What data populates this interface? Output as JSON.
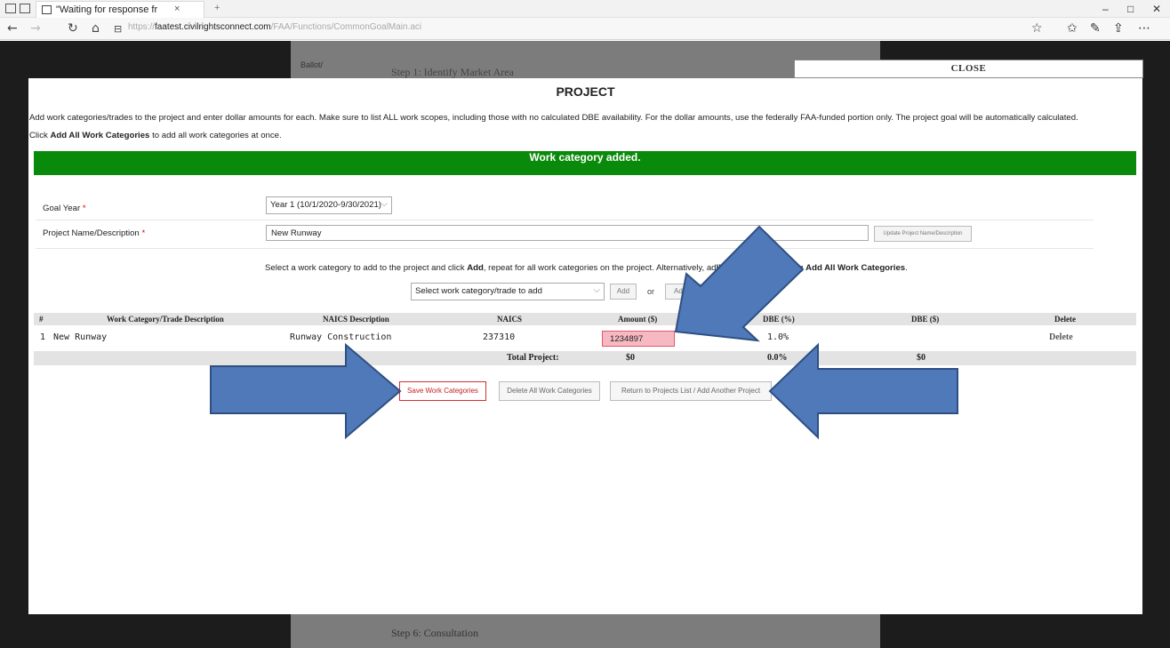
{
  "browser": {
    "tab_title": "\"Waiting for response fr",
    "tab_close": "×",
    "new_tab": "+",
    "url_host": "faatest.civilrightsconnect.com",
    "url_prefix": "https://",
    "url_path": "/FAA/Functions/CommonGoalMain.aci",
    "window_controls": [
      "–",
      "□",
      "✕"
    ]
  },
  "background": {
    "title_text": "Step 1: Identify Market Area",
    "label_text": "Ballot/",
    "footer_text": "Step 6: Consultation"
  },
  "modal": {
    "close_label": "CLOSE",
    "title": "PROJECT",
    "instruction_1": "Add work categories/trades to the project and enter dollar amounts for each. Make sure to list ALL work scopes, including those with no calculated DBE availability. For the dollar amounts, use the federally FAA-funded portion only. The project goal will be automatically calculated.",
    "instruction_2_pre": "Click ",
    "instruction_2_bold": "Add All Work Categories",
    "instruction_2_post": " to add all work categories at once.",
    "success_message": "Work category added.",
    "goal_year_label": "Goal Year",
    "goal_year_value": "Year 1 (10/1/2020-9/30/2021)",
    "project_name_label": "Project Name/Description",
    "project_name_value": "New Runway",
    "update_name_button": "Update Project Name/Description",
    "select_instruction_1": "Select a work category to add to the project and click ",
    "select_instruction_add": "Add",
    "select_instruction_2": ", repeat for all work categories on the project. Alternatively, ad",
    "select_instruction_3": "ll wo",
    "select_instruction_4": "ng ",
    "select_instruction_bold": "Add All Work Categories",
    "select_instruction_end": ".",
    "category_placeholder": "Select work category/trade to add",
    "add_button": "Add",
    "or_text": "or",
    "add_all_button": "Add",
    "table": {
      "headers": [
        "#",
        "Work Category/Trade Description",
        "NAICS Description",
        "NAICS",
        "Amount ($)",
        "DBE (%)",
        "DBE ($)",
        "Delete"
      ],
      "row": {
        "num": "1",
        "category": "New Runway",
        "naics_desc": "Runway Construction",
        "naics": "237310",
        "amount": "1234897",
        "dbe_pct": "1.0%",
        "delete": "Delete"
      },
      "total_label": "Total Project:",
      "total_amount": "$0",
      "total_dbe_pct": "0.0%",
      "total_dbe_amt": "$0"
    },
    "save_button": "Save Work Categories",
    "delete_all_button": "Delete All Work Categories",
    "return_button": "Return to Projects List / Add Another Project"
  },
  "colors": {
    "success": "#0a8a0a",
    "arrow_fill": "#4f79b8",
    "arrow_stroke": "#2e4f82",
    "amount_highlight": "#f6b9c2",
    "primary_button_text": "#c81e1e"
  },
  "icons": [
    "back-icon",
    "forward-icon",
    "refresh-icon",
    "home-icon",
    "lock-icon",
    "favorite-star-icon",
    "favorites-list-icon",
    "pen-icon",
    "share-icon",
    "more-icon"
  ]
}
